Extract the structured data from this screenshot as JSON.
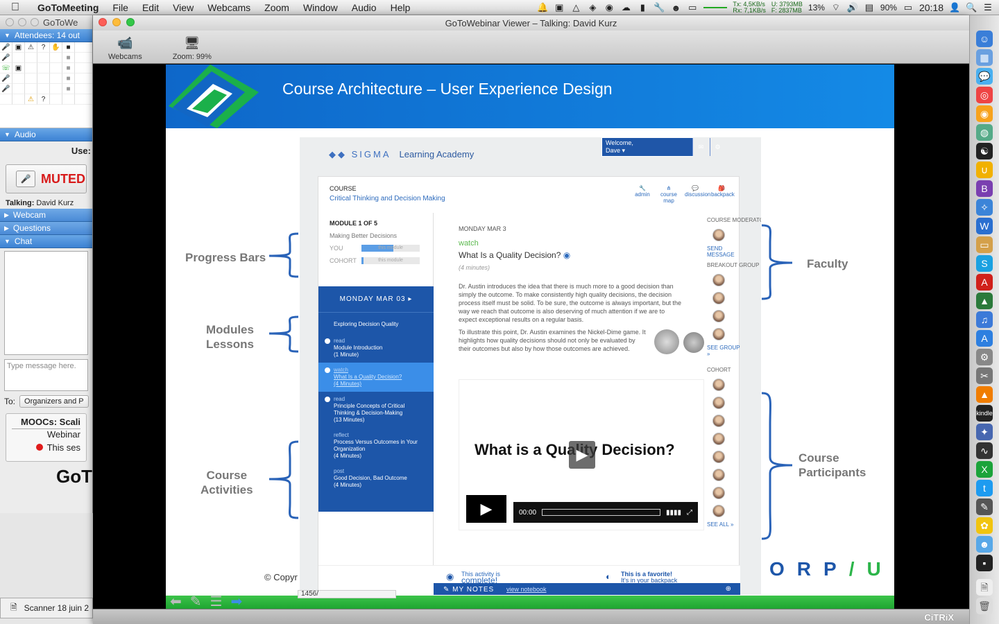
{
  "menubar": {
    "app": "GoToMeeting",
    "items": [
      "File",
      "Edit",
      "View",
      "Webcams",
      "Zoom",
      "Window",
      "Audio",
      "Help"
    ],
    "net_tx": "Tx: 4,5KB/s",
    "net_rx": "Rx: 7,1KB/s",
    "mem_u": "U: 3793MB",
    "mem_f": "F: 2837MB",
    "cpu": "13%",
    "battery": "90%",
    "time": "20:18"
  },
  "left_panel": {
    "title": "GoToWe",
    "attendees": "Attendees: 14 out",
    "audio": "Audio",
    "use_label": "Use:",
    "muted": "MUTED",
    "talking_label": "Talking:",
    "talking_name": "David Kurz",
    "sections": [
      "Webcam",
      "Questions",
      "Chat"
    ],
    "chat_placeholder": "Type message here.",
    "to_label": "To:",
    "to_value": "Organizers and P",
    "card_line1": "MOOCs: Scali",
    "card_line2": "Webinar",
    "card_line3": "This ses",
    "brand": "GoT",
    "scanner": "Scanner 18 juin 2"
  },
  "viewer": {
    "title": "GoToWebinar Viewer – Talking: David Kurz",
    "toolbar": [
      {
        "label": "Webcams",
        "icon": "webcam-icon"
      },
      {
        "label": "Zoom: 99%",
        "icon": "monitor-icon"
      }
    ],
    "page_value": "1456/",
    "footer_brand": "CiTRiX"
  },
  "slide": {
    "title": "Course Architecture – User Experience Design",
    "labels": {
      "progress": "Progress Bars",
      "modules1": "Modules",
      "modules2": "Lessons",
      "activities1": "Course",
      "activities2": "Activities",
      "faculty": "Faculty",
      "participants1": "Course",
      "participants2": "Participants"
    },
    "copyright": "© Copyr",
    "corpu": [
      "O",
      "R",
      "P",
      "/",
      "U"
    ]
  },
  "mockup": {
    "brand": "SIGMA",
    "academy": "Learning Academy",
    "welcome1": "Welcome,",
    "welcome2": "Dave ▾",
    "course_label": "COURSE",
    "course_title": "Critical Thinking and Decision Making",
    "tools": [
      "admin",
      "course map",
      "discussion",
      "backpack"
    ],
    "module_label": "MODULE 1 OF 5",
    "module_title": "Making Better Decisions",
    "you": "YOU",
    "cohort": "COHORT",
    "bar_text": "this module",
    "you_progress": 0.55,
    "cohort_progress": 0.03,
    "date": "MONDAY MAR 03",
    "lesson_header": "Exploring Decision Quality",
    "lessons": [
      {
        "kind": "read",
        "title": "Module Introduction",
        "mins": "(1 Minute)"
      },
      {
        "kind": "watch",
        "title": "What Is a Quality Decision?",
        "mins": "(4 Minutes)"
      },
      {
        "kind": "read",
        "title": "Principle Concepts of Critical Thinking & Decision-Making",
        "mins": "(13 Minutes)"
      },
      {
        "kind": "reflect",
        "title": "Process Versus Outcomes in Your Organization",
        "mins": "(4 Minutes)"
      },
      {
        "kind": "post",
        "title": "Good Decision, Bad Outcome",
        "mins": "(4 Minutes)"
      }
    ],
    "content_date": "MONDAY MAR 3",
    "watch": "watch",
    "question": "What Is a Quality Decision?",
    "minutes": "(4 minutes)",
    "para1": "Dr. Austin introduces the idea that there is much more to a good decision than simply the outcome. To make consistently high quality decisions, the decision process itself must be solid. To be sure, the outcome is always important, but the way we reach that outcome is also deserving of much attention if we are to expect exceptional results on a regular basis.",
    "para2": "To illustrate this point, Dr. Austin examines the Nickel-Dime game. It highlights how quality decisions should not only be evaluated by their outcomes but also by how those outcomes are achieved.",
    "video_title": "What is a Quality Decision?",
    "video_time": "00:00",
    "moderator": "COURSE MODERATOR",
    "send": "SEND MESSAGE",
    "breakout": "BREAKOUT GROUP",
    "see_group": "SEE GROUP »",
    "cohort_h": "COHORT",
    "see_all": "SEE ALL »",
    "complete1": "This activity is",
    "complete2": "complete!",
    "favorite1": "This is a favorite!",
    "favorite2": "It's in your backpack",
    "my_notes": "MY NOTES",
    "view_notebook": "view notebook"
  }
}
